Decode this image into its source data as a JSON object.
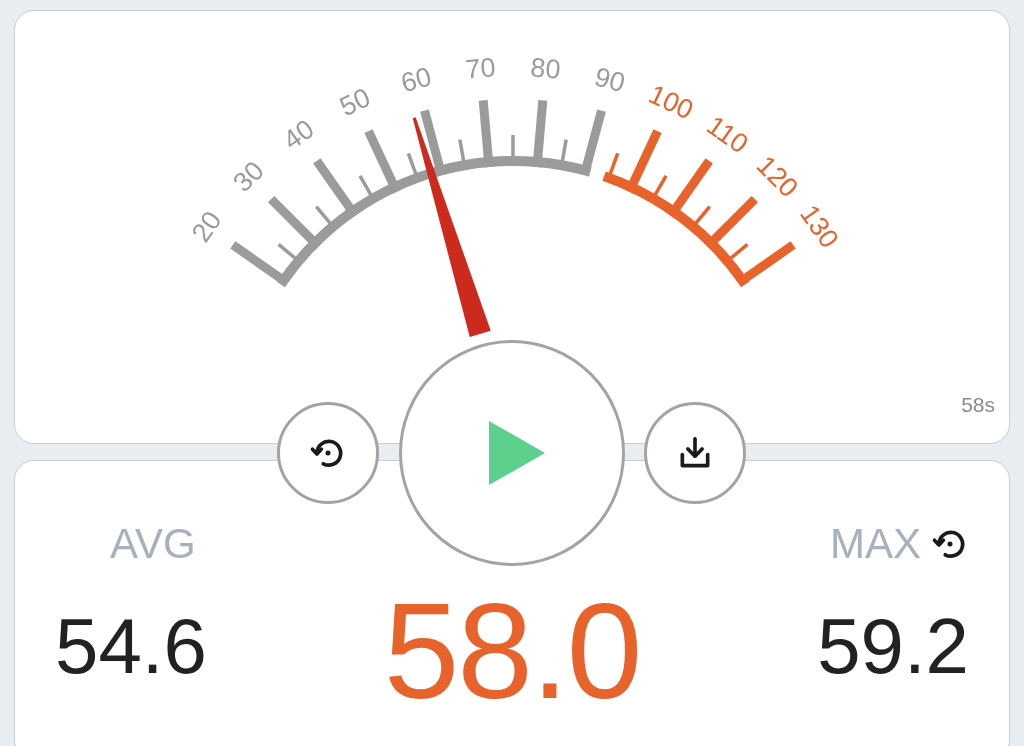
{
  "meter": {
    "ticks": [
      {
        "label": "20",
        "color": "#9b9b9b"
      },
      {
        "label": "30",
        "color": "#9b9b9b"
      },
      {
        "label": "40",
        "color": "#9b9b9b"
      },
      {
        "label": "50",
        "color": "#9b9b9b"
      },
      {
        "label": "60",
        "color": "#9b9b9b"
      },
      {
        "label": "70",
        "color": "#9b9b9b"
      },
      {
        "label": "80",
        "color": "#9b9b9b"
      },
      {
        "label": "90",
        "color": "#9b9b9b"
      },
      {
        "label": "100",
        "color": "#e8622c"
      },
      {
        "label": "110",
        "color": "#e8622c"
      },
      {
        "label": "120",
        "color": "#e8622c"
      },
      {
        "label": "130",
        "color": "#e8622c"
      }
    ],
    "elapsed": "58s"
  },
  "controls": [
    {
      "kind": "reset"
    },
    {
      "kind": "play"
    },
    {
      "kind": "download"
    }
  ],
  "stats": {
    "avg": {
      "label": "AVG",
      "value": "54.6"
    },
    "current": "58.0",
    "max": {
      "label": "MAX",
      "value": "59.2"
    }
  }
}
